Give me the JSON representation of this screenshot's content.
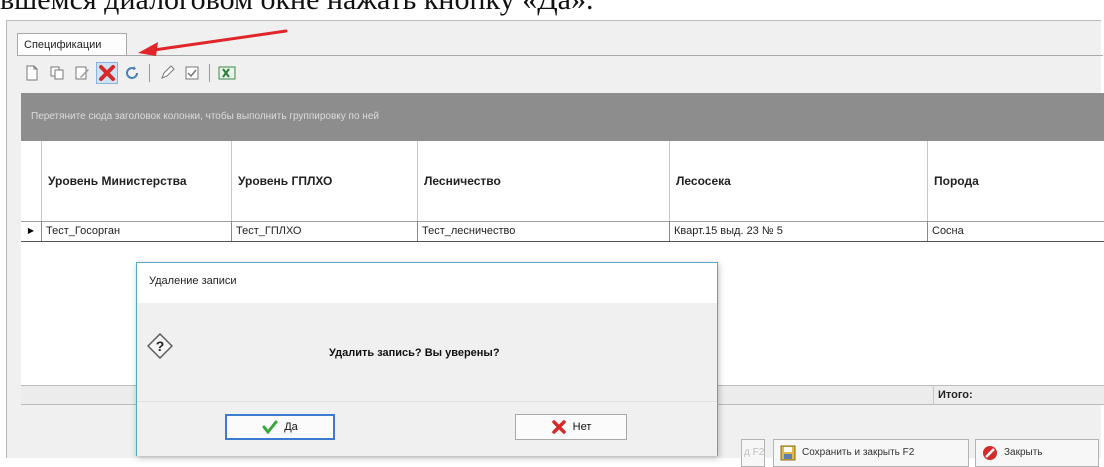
{
  "document": {
    "text_line": "вшемся диалоговом окне нажать кнопку «Да»."
  },
  "tab": {
    "label": "Спецификации"
  },
  "toolbar": {
    "buttons": [
      {
        "icon": "new-document-icon",
        "glyph": "🗋"
      },
      {
        "icon": "copy-icon",
        "glyph": "⧉"
      },
      {
        "icon": "edit-icon",
        "glyph": "✎"
      },
      {
        "icon": "delete-icon",
        "glyph": "✖"
      },
      {
        "icon": "refresh-icon",
        "glyph": "⟳"
      },
      {
        "icon": "pencil-icon",
        "glyph": "✐"
      },
      {
        "icon": "checkbox-icon",
        "glyph": "☑"
      },
      {
        "icon": "excel-export-icon",
        "glyph": "X"
      }
    ]
  },
  "grid": {
    "group_panel_text": "Перетяните сюда заголовок колонки, чтобы выполнить группировку по ней",
    "columns": [
      "Уровень Министерства",
      "Уровень ГПЛХО",
      "Лесничество",
      "Лесосека",
      "Порода"
    ],
    "rows": [
      [
        "Тест_Госорган",
        "Тест_ГПЛХО",
        "Тест_лесничество",
        "Кварт.15 выд. 23 № 5",
        "Сосна"
      ]
    ],
    "footer_label": "Итого:"
  },
  "buttons": {
    "partial_label": "д F2",
    "save_close_label": "Сохранить и закрыть F2",
    "close_label": "Закрыть"
  },
  "dialog": {
    "title": "Удаление записи",
    "message": "Удалить запись? Вы уверены?",
    "yes_label": "Да",
    "no_label": "Нет"
  },
  "colors": {
    "group_panel_bg": "#8d8d8d",
    "annotation_arrow": "#e0262b",
    "dialog_border": "#59a7c7",
    "delete_red": "#d42a2a",
    "checkmark_green": "#3aa53a"
  }
}
